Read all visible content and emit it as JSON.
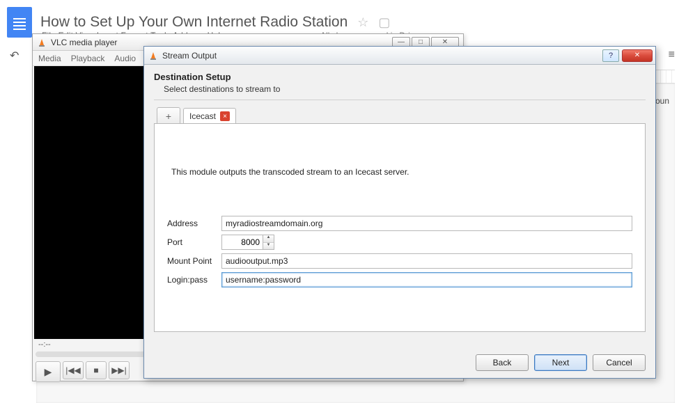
{
  "gdocs": {
    "title": "How to Set Up Your Own Internet Radio Station",
    "menu_hint": "File   Edit   View   Insert   Format   Tools   Add-ons   Help",
    "save_hint": "All changes saved in Drive",
    "body_word": "moun"
  },
  "vlc": {
    "title": "VLC media player",
    "menus": [
      "Media",
      "Playback",
      "Audio"
    ],
    "time": "--:--",
    "buttons": {
      "play": "▶",
      "prev": "|◀◀",
      "stop": "■",
      "next": "▶▶|"
    }
  },
  "so": {
    "title": "Stream Output",
    "heading": "Destination Setup",
    "sub": "Select destinations to stream to",
    "add_tab_icon": "+",
    "tab_label": "Icecast",
    "tab_close": "×",
    "module_desc": "This module outputs the transcoded stream to an Icecast server.",
    "fields": {
      "address_label": "Address",
      "address_value": "myradiostreamdomain.org",
      "port_label": "Port",
      "port_value": "8000",
      "mount_label": "Mount Point",
      "mount_value": "audiooutput.mp3",
      "login_label": "Login:pass",
      "login_value": "username:password"
    },
    "buttons": {
      "back": "Back",
      "next": "Next",
      "cancel": "Cancel",
      "help": "?",
      "close": "✕"
    }
  },
  "winctrl": {
    "min": "—",
    "max": "□",
    "close": "✕"
  }
}
